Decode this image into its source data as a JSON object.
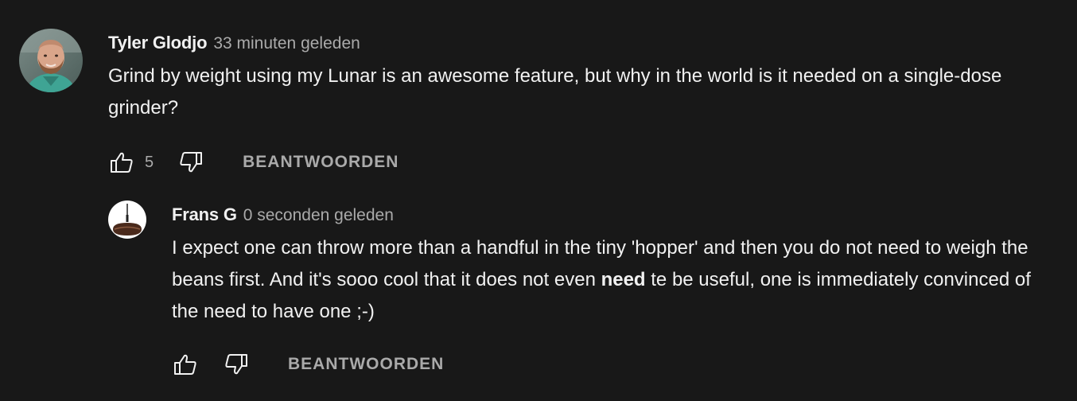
{
  "comments": [
    {
      "author": "Tyler Glodjo",
      "time": "33 minuten geleden",
      "text": "Grind by weight using my Lunar is an awesome feature, but why in the world is it needed on a single-dose grinder?",
      "likes": "5",
      "reply_label": "BEANTWOORDEN"
    }
  ],
  "reply": {
    "author": "Frans G",
    "time": "0 seconden geleden",
    "text_before": "I expect one can throw more than a handful in the tiny 'hopper' and then you do not need to weigh the beans first. And it's sooo cool that it does not even ",
    "text_bold": "need",
    "text_after": " te be useful, one is immediately convinced of the need to have one ;-)",
    "reply_label": "BEANTWOORDEN"
  },
  "icons": {
    "like": "thumbs-up-icon",
    "dislike": "thumbs-down-icon"
  },
  "colors": {
    "background": "#181818",
    "primary_text": "#f1f1f1",
    "secondary_text": "#aaaaaa"
  }
}
